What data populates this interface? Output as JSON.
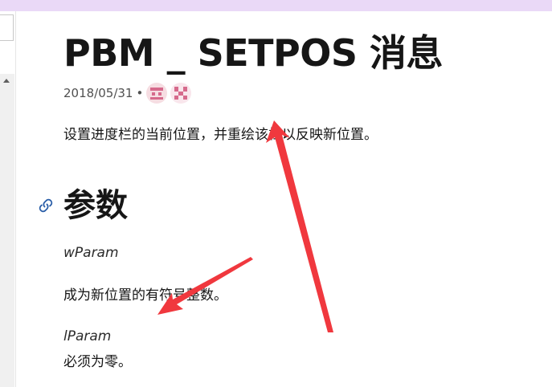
{
  "article": {
    "title": "PBM _ SETPOS 消息",
    "date": "2018/05/31",
    "separator": "•",
    "description": "设置进度栏的当前位置，并重绘该栏以反映新位置。",
    "section_heading": "参数",
    "params": [
      {
        "name": "wParam",
        "description": "成为新位置的有符号整数。"
      },
      {
        "name": "lParam",
        "description": "必须为零。"
      }
    ],
    "contributors": [
      "contributor-avatar",
      "contributor-avatar"
    ]
  },
  "colors": {
    "top_bar": "#ead9f7",
    "annotation_arrow": "#f0383e",
    "link_icon": "#2a5ea8"
  }
}
